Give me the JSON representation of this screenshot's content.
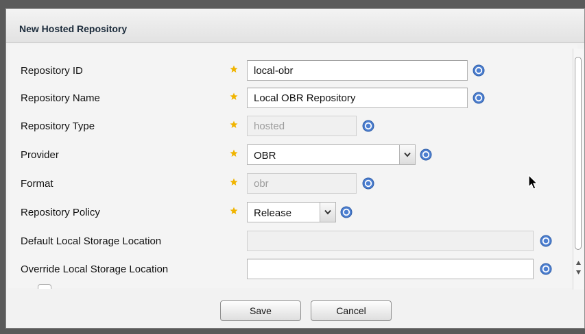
{
  "panel": {
    "title": "New Hosted Repository"
  },
  "form": {
    "repository_id": {
      "label": "Repository ID",
      "value": "local-obr",
      "required": true
    },
    "repository_name": {
      "label": "Repository Name",
      "value": "Local OBR Repository",
      "required": true
    },
    "repository_type": {
      "label": "Repository Type",
      "value": "hosted",
      "required": true,
      "readonly": true
    },
    "provider": {
      "label": "Provider",
      "value": "OBR",
      "required": true
    },
    "format": {
      "label": "Format",
      "value": "obr",
      "required": true,
      "readonly": true
    },
    "repository_policy": {
      "label": "Repository Policy",
      "value": "Release",
      "required": true
    },
    "default_storage": {
      "label": "Default Local Storage Location",
      "value": ""
    },
    "override_storage": {
      "label": "Override Local Storage Location",
      "value": ""
    }
  },
  "buttons": {
    "save": "Save",
    "cancel": "Cancel"
  },
  "colors": {
    "required_star": "#f0b400",
    "help_icon": "#4d7fd0",
    "background": "#f2f2f2"
  },
  "icons": {
    "required": "star-icon",
    "help": "help-icon",
    "dropdown": "chevron-down-icon",
    "pointer": "mouse-cursor-icon"
  }
}
